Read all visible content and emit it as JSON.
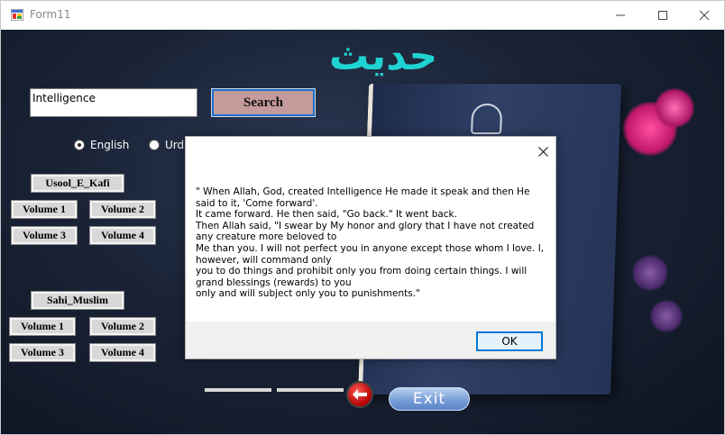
{
  "window": {
    "title": "Form11"
  },
  "header": {
    "heading": "حدیث"
  },
  "search": {
    "value": "Intelligence",
    "button_label": "Search"
  },
  "language": {
    "english_label": "English",
    "urdu_label": "Urdu",
    "selected": "English"
  },
  "usool_e_kafi": {
    "title": "Usool_E_Kafi",
    "volumes": [
      "Volume 1",
      "Volume 2",
      "Volume 3",
      "Volume 4"
    ]
  },
  "sahi_muslim": {
    "title": "Sahi_Muslim",
    "volumes": [
      "Volume 1",
      "Volume 2",
      "Volume 3",
      "Volume 4"
    ]
  },
  "dialog": {
    "message": "\" When Allah, God, created Intelligence He made it speak and then He said to it, 'Come forward'.\nIt came forward. He then said, \"Go back.\" It went back.\nThen Allah said, \"I swear by My honor and glory that I have not created any creature more beloved to\nMe than you. I will not perfect you in anyone except those whom I love. I, however, will command only\nyou to do things and prohibit only you from doing certain things. I will grand blessings (rewards) to you\nonly and will subject only you to punishments.\"",
    "ok_label": "OK"
  },
  "footer": {
    "exit_label": "Exit"
  },
  "colors": {
    "heading": "#1fd3d3",
    "search_button": "#c49a9a",
    "focus_border": "#0078d7"
  }
}
